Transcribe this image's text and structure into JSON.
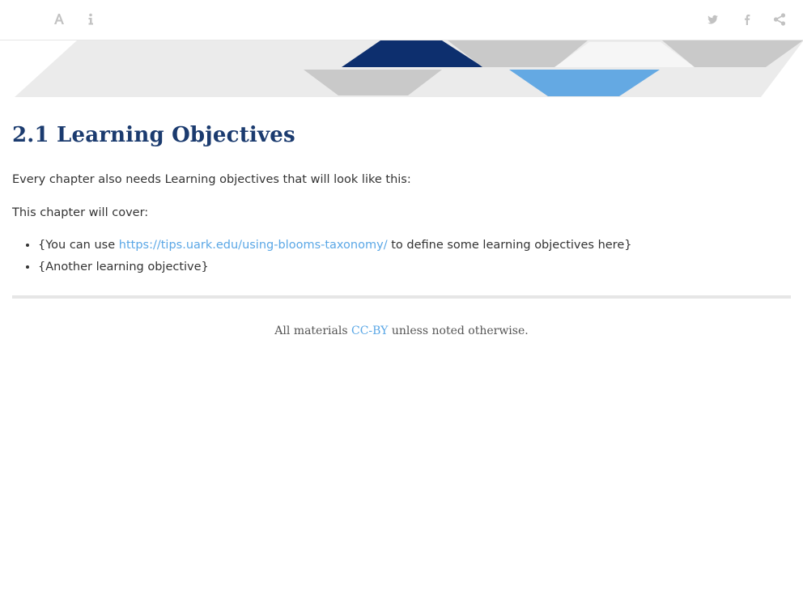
{
  "toolbar": {
    "left_buttons": [
      {
        "icon": "font-size-icon"
      },
      {
        "icon": "info-icon"
      }
    ],
    "right_buttons": [
      {
        "icon": "twitter-icon"
      },
      {
        "icon": "facebook-icon"
      },
      {
        "icon": "share-icon"
      }
    ]
  },
  "section": {
    "number": "2.1",
    "title": "Learning Objectives"
  },
  "body": {
    "intro": "Every chapter also needs Learning objectives that will look like this:",
    "covers": "This chapter will cover:",
    "objectives": [
      {
        "prefix": "{You can use ",
        "link_text": "https://tips.uark.edu/using-blooms-taxonomy/",
        "suffix": " to define some learning objectives here}"
      },
      {
        "text": "{Another learning objective}"
      }
    ]
  },
  "footer": {
    "prefix": "All materials ",
    "link_text": "CC-BY",
    "suffix": " unless noted otherwise."
  },
  "colors": {
    "heading": "#1b3b6f",
    "link": "#5aa7e6",
    "banner_dark_blue": "#0d2f6e",
    "banner_light_blue": "#64a9e3",
    "banner_gray": "#c9c9c9",
    "banner_light_gray": "#ebebeb"
  }
}
